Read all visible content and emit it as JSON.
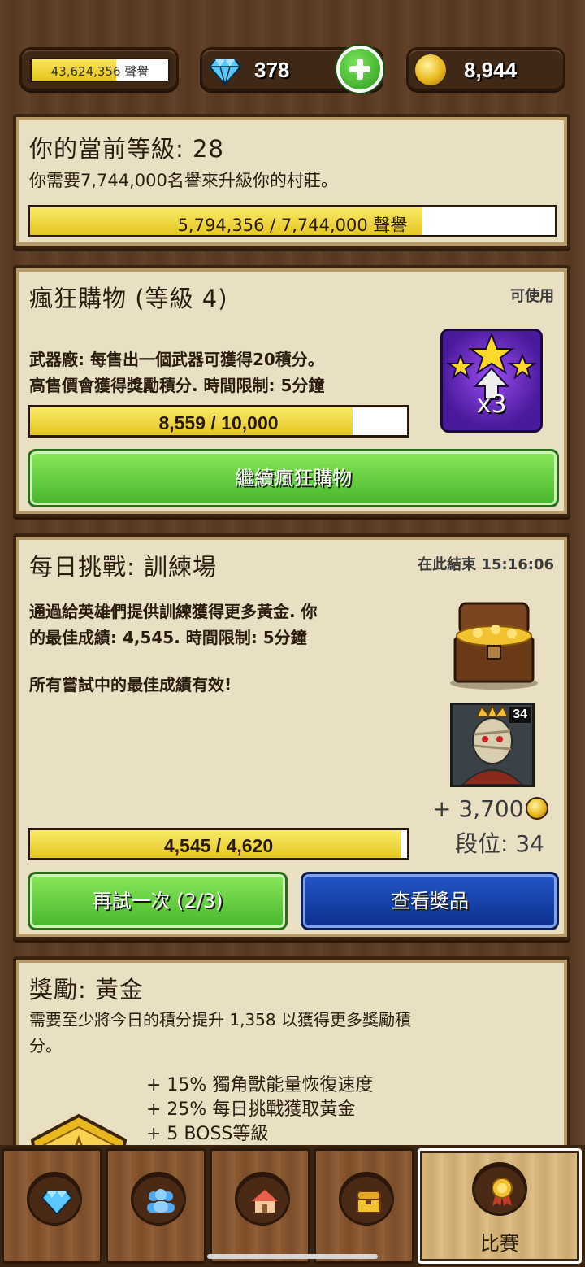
{
  "header": {
    "reputation_text": "43,624,356 聲譽",
    "reputation_fill": 0.62,
    "gems": "378",
    "gold": "8,944"
  },
  "level_panel": {
    "title": "你的當前等級: 28",
    "description": "你需要7,744,000名譽來升級你的村莊。",
    "progress_text": "5,794,356 / 7,744,000 聲譽",
    "progress_fraction": 0.748
  },
  "shopping_panel": {
    "title": "瘋狂購物 (等級 4)",
    "status": "可使用",
    "line1": "武器廠: 每售出一個武器可獲得20積分。",
    "line2": "高售價會獲得獎勵積分. 時間限制: 5分鐘",
    "progress_text": "8,559 / 10,000",
    "progress_fraction": 0.856,
    "boost_label": "x3",
    "continue_button": "繼續瘋狂購物"
  },
  "challenge_panel": {
    "title": "每日挑戰: 訓練場",
    "ends_text": "在此結束 15:16:06",
    "line1": "通過給英雄們提供訓練獲得更多黃金. 你",
    "line2": "的最佳成績: 4,545. 時間限制: 5分鐘",
    "line3": "所有嘗試中的最佳成績有效!",
    "rank_badge": "34",
    "reward_gold": "+ 3,700",
    "rank_text": "段位: 34",
    "progress_text": "4,545 / 4,620",
    "progress_fraction": 0.984,
    "retry_button": "再試一次 (2/3)",
    "prizes_button": "查看獎品"
  },
  "reward_panel": {
    "title": "獎勵: 黃金",
    "line1": "需要至少將今日的積分提升 1,358 以獲得更多獎勵積",
    "line2": "分。",
    "bonuses": [
      "+ 15% 獨角獸能量恢復速度",
      "+ 25% 每日挑戰獲取黃金",
      "+ 5 BOSS等級"
    ]
  },
  "nav": {
    "items": [
      {
        "icon": "gem-icon",
        "label": ""
      },
      {
        "icon": "group-icon",
        "label": ""
      },
      {
        "icon": "village-icon",
        "label": ""
      },
      {
        "icon": "chest-icon",
        "label": ""
      },
      {
        "icon": "medal-icon",
        "label": "比賽"
      }
    ]
  },
  "colors": {
    "bar_fill": "#e7c823",
    "green_button": "#45b52b",
    "blue_button": "#0c2f8c",
    "panel_bg": "#e9dfc3"
  }
}
